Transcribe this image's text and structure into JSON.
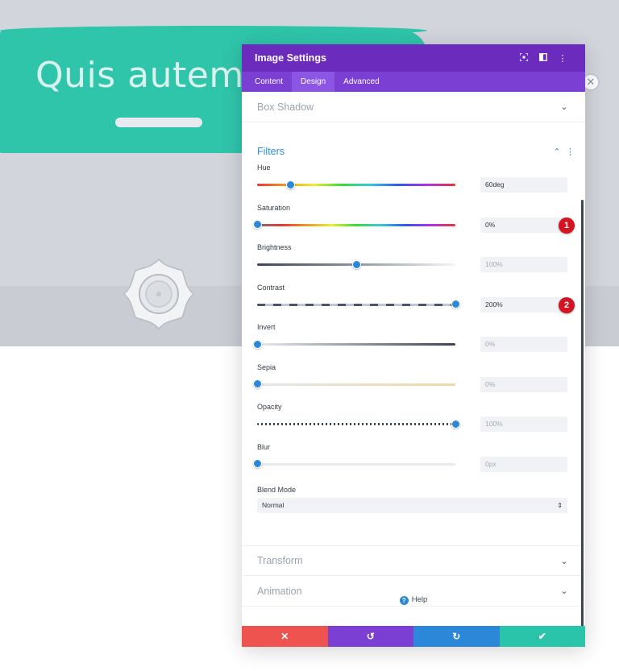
{
  "background": {
    "hero_title": "Quis autem v",
    "accent_color": "#2fc5ab",
    "close_icon": "close-icon"
  },
  "modal": {
    "title": "Image Settings",
    "header_icons": [
      "fullscreen-icon",
      "split-view-icon",
      "more-vertical-icon"
    ],
    "header_color": "#6b2cbd",
    "tabs": [
      {
        "label": "Content",
        "active": false
      },
      {
        "label": "Design",
        "active": true
      },
      {
        "label": "Advanced",
        "active": false
      }
    ],
    "sections_top": [
      {
        "label": "Box Shadow"
      }
    ],
    "filters": {
      "title": "Filters",
      "items": [
        {
          "label": "Hue",
          "value": "60deg",
          "level": 0.17,
          "muted": false,
          "callout": ""
        },
        {
          "label": "Saturation",
          "value": "0%",
          "level": 0.0,
          "muted": false,
          "callout": "1"
        },
        {
          "label": "Brightness",
          "value": "100%",
          "level": 0.5,
          "muted": true,
          "callout": ""
        },
        {
          "label": "Contrast",
          "value": "200%",
          "level": 1.0,
          "muted": false,
          "callout": "2"
        },
        {
          "label": "Invert",
          "value": "0%",
          "level": 0.0,
          "muted": true,
          "callout": ""
        },
        {
          "label": "Sepia",
          "value": "0%",
          "level": 0.0,
          "muted": true,
          "callout": ""
        },
        {
          "label": "Opacity",
          "value": "100%",
          "level": 1.0,
          "muted": true,
          "callout": ""
        },
        {
          "label": "Blur",
          "value": "0px",
          "level": 0.0,
          "muted": true,
          "callout": ""
        }
      ],
      "blend_mode_label": "Blend Mode",
      "blend_mode_value": "Normal"
    },
    "sections_bottom": [
      {
        "label": "Transform"
      },
      {
        "label": "Animation"
      }
    ],
    "help_label": "Help",
    "footer": [
      {
        "name": "discard-button",
        "icon": "✕",
        "color": "#ef5350"
      },
      {
        "name": "undo-button",
        "icon": "↺",
        "color": "#7b3fd4"
      },
      {
        "name": "redo-button",
        "icon": "↻",
        "color": "#2b87d8"
      },
      {
        "name": "save-button",
        "icon": "✔",
        "color": "#29c4a9"
      }
    ]
  }
}
